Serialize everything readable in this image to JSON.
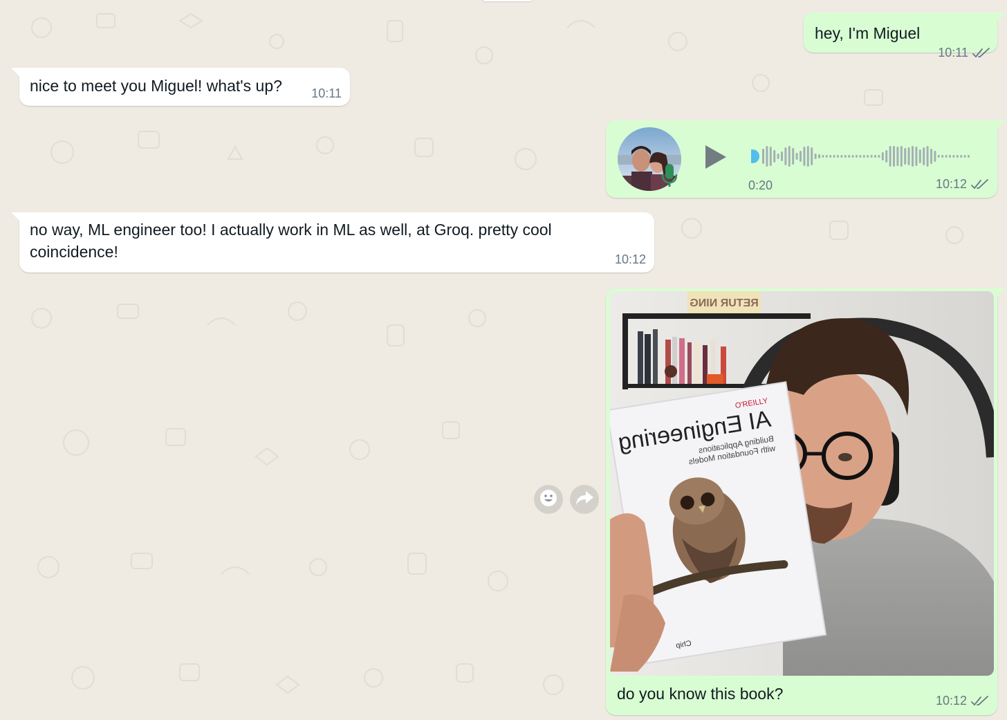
{
  "messages": {
    "m1": {
      "text": "hey, I'm Miguel",
      "time": "10:11"
    },
    "m2": {
      "text": "nice to meet you Miguel! what's up?",
      "time": "10:11"
    },
    "voice": {
      "duration": "0:20",
      "time": "10:12",
      "progress": 0
    },
    "m4": {
      "text": "no way, ML engineer too! I actually work in ML as well, at Groq. pretty cool coincidence!",
      "time": "10:12"
    },
    "photo": {
      "caption": "do you know this book?",
      "time": "10:12",
      "book": {
        "publisher": "O'REILLY",
        "title": "AI Engineering",
        "subtitle_line1": "Building Applications",
        "subtitle_line2": "with Foundation Models",
        "author_fragment": "Chip"
      },
      "poster_text": "RETUR NING"
    }
  },
  "colors": {
    "background": "#efeae2",
    "incoming": "#ffffff",
    "outgoing": "#d9fdd3",
    "read_ticks": "#667781",
    "voice_dot": "#53bdeb"
  },
  "icons": [
    "double-check-icon",
    "play-icon",
    "mic-icon",
    "emoji-icon",
    "forward-icon"
  ]
}
